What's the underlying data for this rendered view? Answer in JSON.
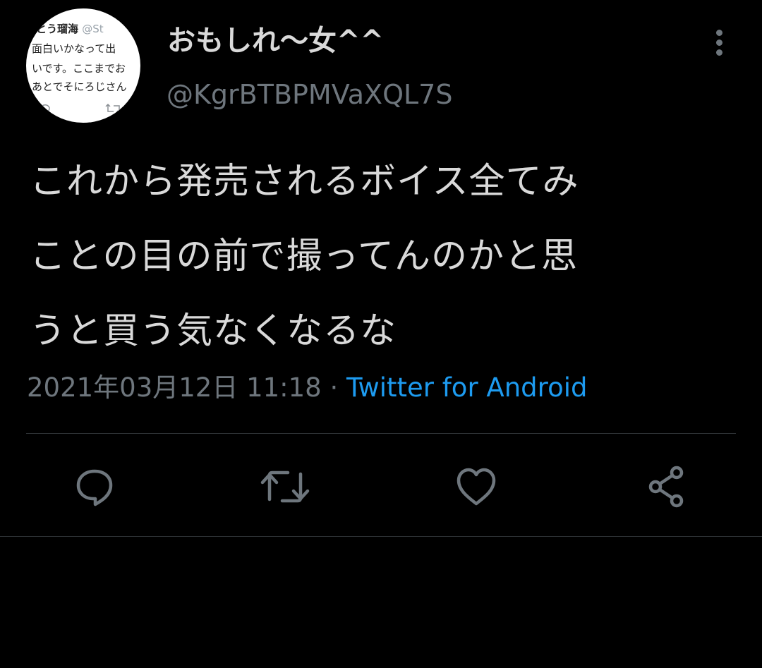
{
  "tweet": {
    "avatar_lines": [
      "とう瑠海 ",
      "@St",
      "面白いかなって出",
      "いです。ここまでお",
      "あとでそにろじさん"
    ],
    "display_name": "おもしれ〜女^^",
    "handle": "@KgrBTBPMVaXQL7S",
    "text_lines": [
      "これから発売されるボイス全てみ",
      "ことの目の前で撮ってんのかと思",
      "うと買う気なくなるな"
    ],
    "timestamp": "2021年03月12日 11:18",
    "separator": " · ",
    "source": "Twitter for Android"
  },
  "icons": {
    "more": "more-vertical-icon",
    "reply": "reply-icon",
    "retweet": "retweet-icon",
    "like": "heart-icon",
    "share": "share-icon"
  },
  "colors": {
    "background": "#000000",
    "text": "#d9d9d9",
    "secondary": "#6e767d",
    "link": "#1d9bf0",
    "border": "#2f3336"
  }
}
